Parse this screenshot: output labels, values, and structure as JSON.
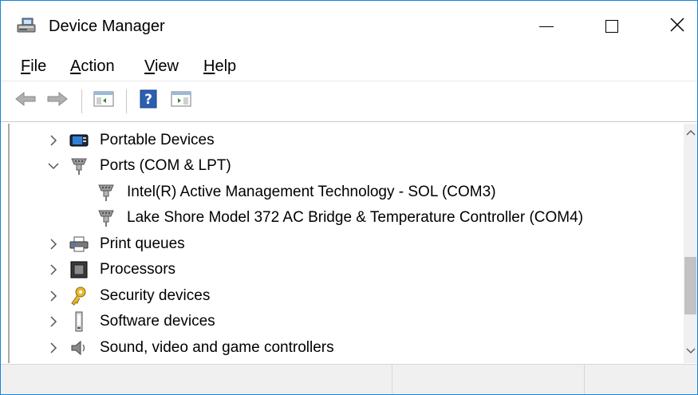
{
  "window": {
    "title": "Device Manager",
    "icon": "device-manager-icon",
    "controls": [
      "minimize-icon",
      "maximize-icon",
      "close-icon"
    ]
  },
  "menu": {
    "items": [
      {
        "accel": "F",
        "rest": "ile"
      },
      {
        "accel": "A",
        "rest": "ction"
      },
      {
        "accel": "V",
        "rest": "iew"
      },
      {
        "accel": "H",
        "rest": "elp"
      }
    ]
  },
  "toolbar": {
    "buttons": [
      "back-arrow-icon",
      "forward-arrow-icon",
      "show-hide-console-tree-icon",
      "help-icon",
      "properties-pane-icon"
    ]
  },
  "tree": {
    "rows": [
      {
        "label": "Portable Devices",
        "icon": "portable-devices-icon",
        "state": "collapsed"
      },
      {
        "label": "Ports (COM & LPT)",
        "icon": "port-connector-icon",
        "state": "expanded"
      },
      {
        "label": "Intel(R) Active Management Technology - SOL (COM3)",
        "icon": "port-connector-icon",
        "state": "leaf"
      },
      {
        "label": "Lake Shore Model 372 AC Bridge & Temperature Controller (COM4)",
        "icon": "port-connector-icon",
        "state": "leaf"
      },
      {
        "label": "Print queues",
        "icon": "printer-icon",
        "state": "collapsed"
      },
      {
        "label": "Processors",
        "icon": "processor-icon",
        "state": "collapsed"
      },
      {
        "label": "Security devices",
        "icon": "security-key-icon",
        "state": "collapsed"
      },
      {
        "label": "Software devices",
        "icon": "software-device-icon",
        "state": "collapsed"
      },
      {
        "label": "Sound, video and game controllers",
        "icon": "speaker-icon",
        "state": "collapsed"
      }
    ]
  },
  "colors": {
    "window_border": "#1883d7",
    "scrollbar_track": "#f0f0f0",
    "scrollbar_thumb": "#c2c2c2",
    "statusbar_bg": "#f0f0f0"
  }
}
